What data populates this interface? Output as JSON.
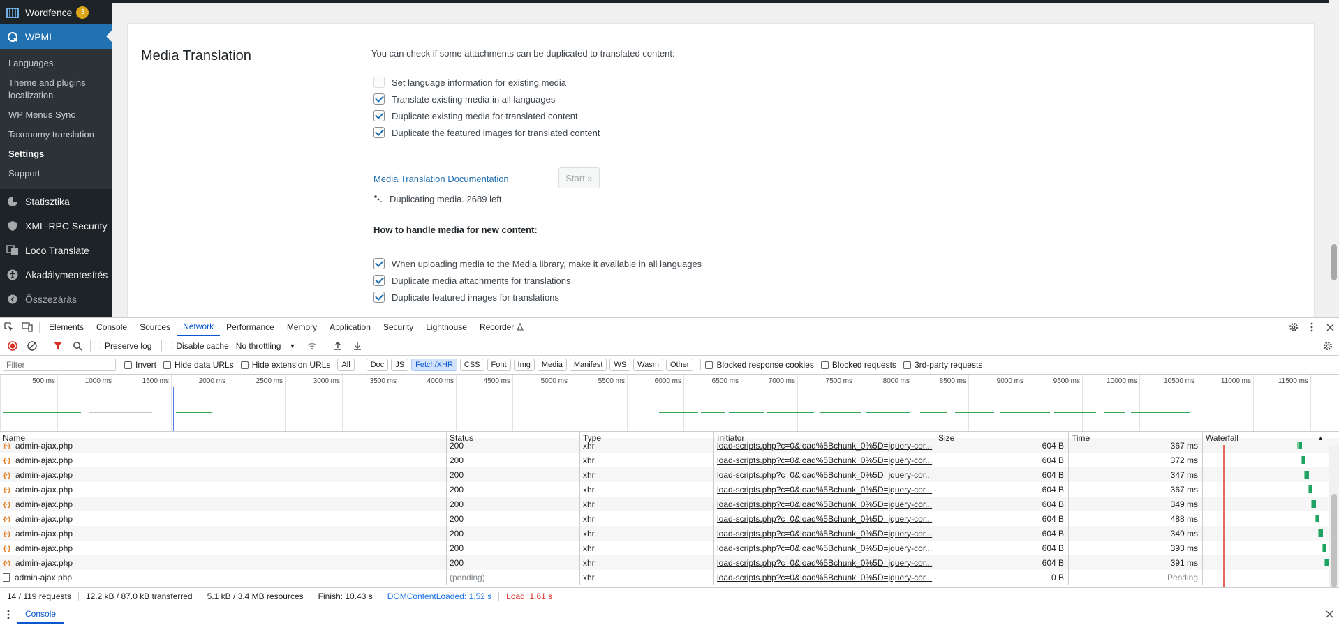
{
  "sidebar": {
    "wordfence": {
      "label": "Wordfence",
      "badge": "3"
    },
    "wpml": {
      "label": "WPML"
    },
    "submenu": [
      {
        "label": "Languages"
      },
      {
        "label": "Theme and plugins localization"
      },
      {
        "label": "WP Menus Sync"
      },
      {
        "label": "Taxonomy translation"
      },
      {
        "label": "Settings"
      },
      {
        "label": "Support"
      }
    ],
    "items": [
      {
        "label": "Statisztika"
      },
      {
        "label": "XML-RPC Security"
      },
      {
        "label": "Loco Translate"
      },
      {
        "label": "Akadálymentesítés"
      },
      {
        "label": "Összezárás"
      }
    ]
  },
  "media_translation": {
    "title": "Media Translation",
    "intro": "You can check if some attachments can be duplicated to translated content:",
    "options": [
      {
        "label": "Set language information for existing media",
        "checked": false
      },
      {
        "label": "Translate existing media in all languages",
        "checked": true
      },
      {
        "label": "Duplicate existing media for translated content",
        "checked": true
      },
      {
        "label": "Duplicate the featured images for translated content",
        "checked": true
      }
    ],
    "doc_link": "Media Translation Documentation",
    "start_button": "Start »",
    "status": "Duplicating media. 2689 left",
    "new_content_heading": "How to handle media for new content:",
    "new_options": [
      {
        "label": "When uploading media to the Media library, make it available in all languages",
        "checked": true
      },
      {
        "label": "Duplicate media attachments for translations",
        "checked": true
      },
      {
        "label": "Duplicate featured images for translations",
        "checked": true
      }
    ]
  },
  "devtools": {
    "tabs": [
      "Elements",
      "Console",
      "Sources",
      "Network",
      "Performance",
      "Memory",
      "Application",
      "Security",
      "Lighthouse",
      "Recorder"
    ],
    "active_tab": "Network",
    "toolbar": {
      "preserve_log": "Preserve log",
      "disable_cache": "Disable cache",
      "throttling": "No throttling"
    },
    "filter": {
      "placeholder": "Filter",
      "invert": "Invert",
      "hide_data_urls": "Hide data URLs",
      "hide_extension_urls": "Hide extension URLs",
      "types": [
        "All",
        "Doc",
        "JS",
        "Fetch/XHR",
        "CSS",
        "Font",
        "Img",
        "Media",
        "Manifest",
        "WS",
        "Wasm",
        "Other"
      ],
      "active_type": "Fetch/XHR",
      "blocked_cookies": "Blocked response cookies",
      "blocked_requests": "Blocked requests",
      "third_party": "3rd-party requests"
    },
    "overview_ticks": [
      "500 ms",
      "1000 ms",
      "1500 ms",
      "2000 ms",
      "2500 ms",
      "3000 ms",
      "3500 ms",
      "4000 ms",
      "4500 ms",
      "5000 ms",
      "5500 ms",
      "6000 ms",
      "6500 ms",
      "7000 ms",
      "7500 ms",
      "8000 ms",
      "8500 ms",
      "9000 ms",
      "9500 ms",
      "10000 ms",
      "10500 ms",
      "11000 ms",
      "11500 ms"
    ],
    "columns": [
      "Name",
      "Status",
      "Type",
      "Initiator",
      "Size",
      "Time",
      "Waterfall"
    ],
    "rows": [
      {
        "name": "admin-ajax.php",
        "status": "200",
        "type": "xhr",
        "initiator": "load-scripts.php?c=0&load%5Bchunk_0%5D=jquery-cor...",
        "size": "604 B",
        "time": "367 ms",
        "wf": 0.77
      },
      {
        "name": "admin-ajax.php",
        "status": "200",
        "type": "xhr",
        "initiator": "load-scripts.php?c=0&load%5Bchunk_0%5D=jquery-cor...",
        "size": "604 B",
        "time": "372 ms",
        "wf": 0.8
      },
      {
        "name": "admin-ajax.php",
        "status": "200",
        "type": "xhr",
        "initiator": "load-scripts.php?c=0&load%5Bchunk_0%5D=jquery-cor...",
        "size": "604 B",
        "time": "347 ms",
        "wf": 0.83
      },
      {
        "name": "admin-ajax.php",
        "status": "200",
        "type": "xhr",
        "initiator": "load-scripts.php?c=0&load%5Bchunk_0%5D=jquery-cor...",
        "size": "604 B",
        "time": "367 ms",
        "wf": 0.86
      },
      {
        "name": "admin-ajax.php",
        "status": "200",
        "type": "xhr",
        "initiator": "load-scripts.php?c=0&load%5Bchunk_0%5D=jquery-cor...",
        "size": "604 B",
        "time": "349 ms",
        "wf": 0.89
      },
      {
        "name": "admin-ajax.php",
        "status": "200",
        "type": "xhr",
        "initiator": "load-scripts.php?c=0&load%5Bchunk_0%5D=jquery-cor...",
        "size": "604 B",
        "time": "488 ms",
        "wf": 0.92
      },
      {
        "name": "admin-ajax.php",
        "status": "200",
        "type": "xhr",
        "initiator": "load-scripts.php?c=0&load%5Bchunk_0%5D=jquery-cor...",
        "size": "604 B",
        "time": "349 ms",
        "wf": 0.95
      },
      {
        "name": "admin-ajax.php",
        "status": "200",
        "type": "xhr",
        "initiator": "load-scripts.php?c=0&load%5Bchunk_0%5D=jquery-cor...",
        "size": "604 B",
        "time": "393 ms",
        "wf": 0.98
      },
      {
        "name": "admin-ajax.php",
        "status": "200",
        "type": "xhr",
        "initiator": "load-scripts.php?c=0&load%5Bchunk_0%5D=jquery-cor...",
        "size": "604 B",
        "time": "391 ms",
        "wf": 1.0
      },
      {
        "name": "admin-ajax.php",
        "status": "(pending)",
        "type": "xhr",
        "initiator": "load-scripts.php?c=0&load%5Bchunk_0%5D=jquery-cor...",
        "size": "0 B",
        "time": "Pending",
        "wf": null
      }
    ],
    "summary": {
      "requests": "14 / 119 requests",
      "transferred": "12.2 kB / 87.0 kB transferred",
      "resources": "5.1 kB / 3.4 MB resources",
      "finish": "Finish: 10.43 s",
      "dom_loaded": "DOMContentLoaded: 1.52 s",
      "load": "Load: 1.61 s"
    },
    "drawer_tab": "Console"
  }
}
